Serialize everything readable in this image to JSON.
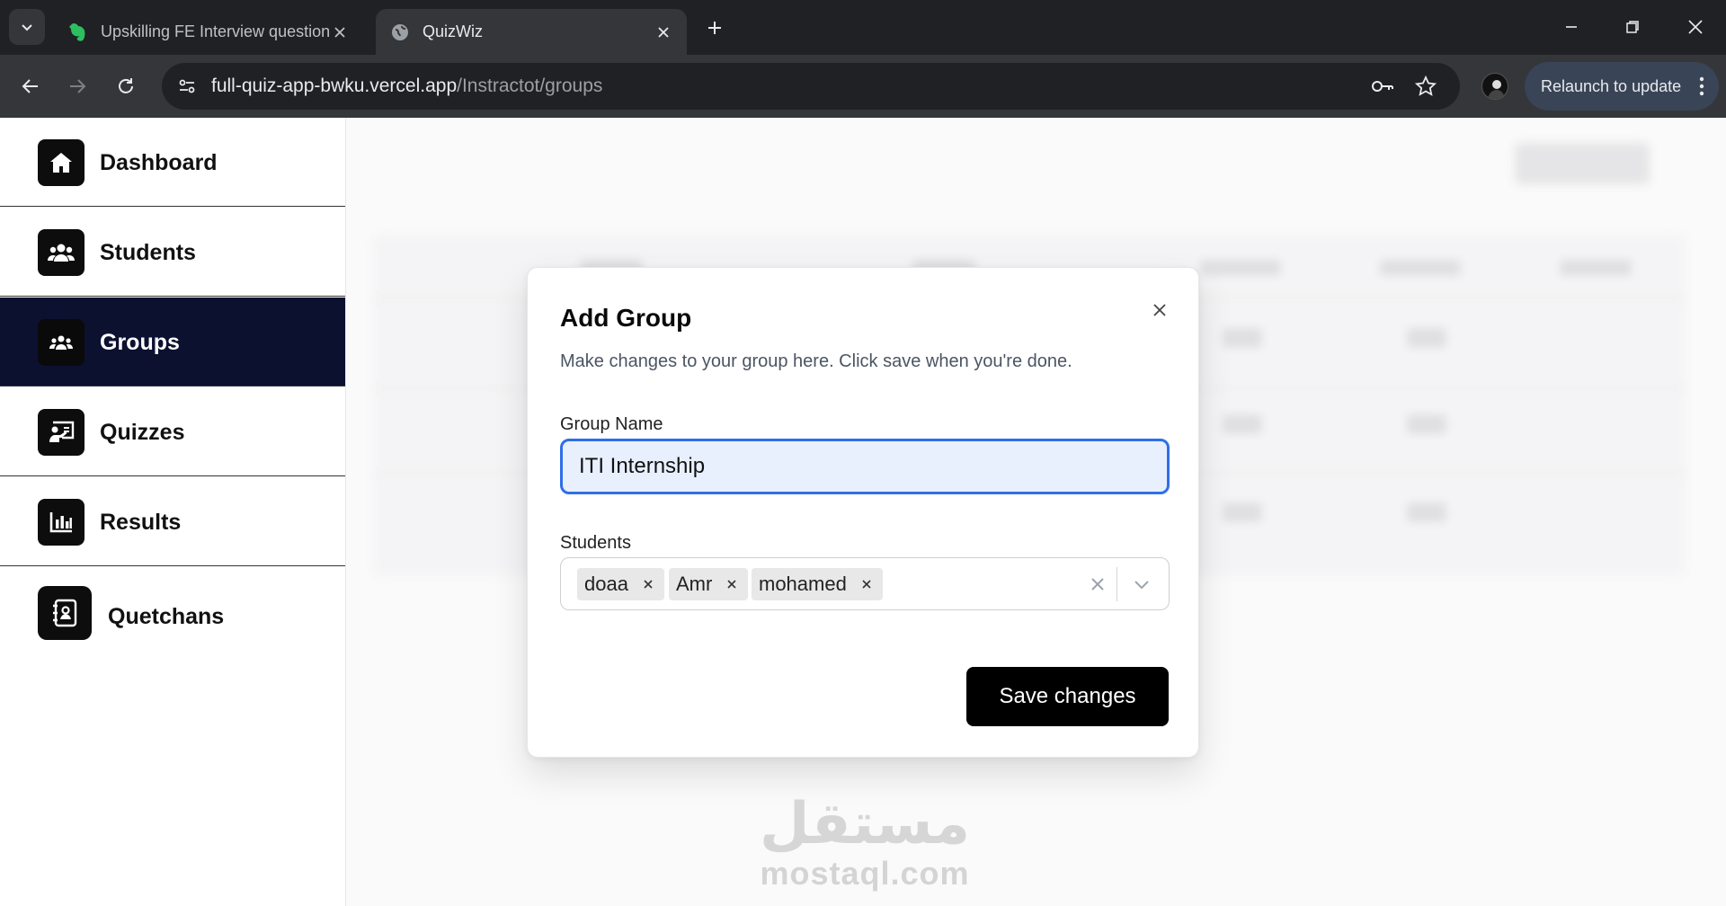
{
  "browser": {
    "tabs": [
      {
        "title": "Upskilling FE Interview questions",
        "icon": "evernote-icon",
        "active": false
      },
      {
        "title": "QuizWiz",
        "icon": "globe-icon",
        "active": true
      }
    ],
    "url_host": "full-quiz-app-bwku.vercel.app",
    "url_path": "/Instractot/groups",
    "relaunch_label": "Relaunch to update"
  },
  "sidebar": {
    "items": [
      {
        "label": "Dashboard",
        "icon": "home-icon",
        "active": false
      },
      {
        "label": "Students",
        "icon": "users-icon",
        "active": false
      },
      {
        "label": "Groups",
        "icon": "group-icon",
        "active": true
      },
      {
        "label": "Quizzes",
        "icon": "presentation-icon",
        "active": false
      },
      {
        "label": "Results",
        "icon": "bar-chart-icon",
        "active": false
      },
      {
        "label": "Quetchans",
        "icon": "address-book-icon",
        "active": false
      }
    ]
  },
  "modal": {
    "title": "Add Group",
    "description": "Make changes to your group here. Click save when you're done.",
    "group_name_label": "Group Name",
    "group_name_value": "ITI Internship",
    "students_label": "Students",
    "selected_students": [
      "doaa",
      "Amr",
      "mohamed"
    ],
    "save_label": "Save changes"
  },
  "watermark": {
    "arabic": "مستقل",
    "latin": "mostaql.com"
  }
}
